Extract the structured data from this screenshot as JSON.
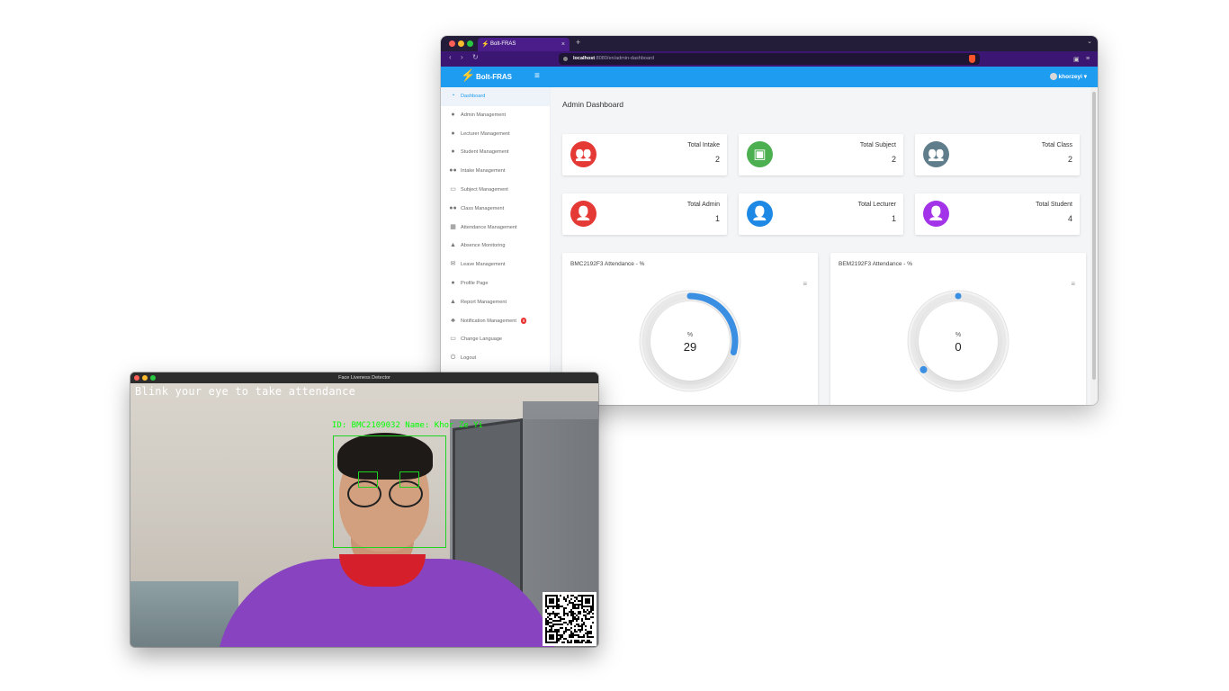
{
  "browser": {
    "tab_title": "Bolt-FRAS",
    "tab_close": "×",
    "new_tab": "+",
    "url_host": "localhost",
    "url_path": ":8080/en/admin-dashboard",
    "user_name": "khorzeyi",
    "user_caret": "▾"
  },
  "app": {
    "brand": "Bolt-FRAS",
    "menu_icon": "≡"
  },
  "sidebar": {
    "items": [
      {
        "label": "Dashboard",
        "icon": "dashboard-icon",
        "glyph": "◔",
        "active": true
      },
      {
        "label": "Admin Management",
        "icon": "user-icon",
        "glyph": "●"
      },
      {
        "label": "Lecturer Management",
        "icon": "user-icon",
        "glyph": "●"
      },
      {
        "label": "Student Management",
        "icon": "user-icon",
        "glyph": "●"
      },
      {
        "label": "Intake Management",
        "icon": "users-icon",
        "glyph": "●●"
      },
      {
        "label": "Subject Management",
        "icon": "chalkboard-icon",
        "glyph": "▭"
      },
      {
        "label": "Class Management",
        "icon": "group-icon",
        "glyph": "●●"
      },
      {
        "label": "Attendance Management",
        "icon": "calendar-icon",
        "glyph": "▦"
      },
      {
        "label": "Absence Monitoring",
        "icon": "warning-icon",
        "glyph": "▲"
      },
      {
        "label": "Leave Management",
        "icon": "envelope-open-icon",
        "glyph": "✉"
      },
      {
        "label": "Profile Page",
        "icon": "user-icon",
        "glyph": "●"
      },
      {
        "label": "Report Management",
        "icon": "warning-icon",
        "glyph": "▲"
      },
      {
        "label": "Notification Management",
        "icon": "bell-icon",
        "glyph": "♣",
        "badge": "8"
      },
      {
        "label": "Change Language",
        "icon": "language-icon",
        "glyph": "▭"
      },
      {
        "label": "Logout",
        "icon": "power-icon",
        "glyph": "⏻"
      }
    ]
  },
  "dashboard": {
    "title": "Admin Dashboard",
    "stats": [
      {
        "label": "Total Intake",
        "value": "2",
        "color": "#e53935",
        "icon": "users-icon"
      },
      {
        "label": "Total Subject",
        "value": "2",
        "color": "#4caf50",
        "icon": "chalkboard-icon"
      },
      {
        "label": "Total Class",
        "value": "2",
        "color": "#607d8b",
        "icon": "group-icon"
      },
      {
        "label": "Total Admin",
        "value": "1",
        "color": "#e53935",
        "icon": "user-icon"
      },
      {
        "label": "Total Lecturer",
        "value": "1",
        "color": "#1e88e5",
        "icon": "user-icon"
      },
      {
        "label": "Total Student",
        "value": "4",
        "color": "#a333e8",
        "icon": "user-icon"
      }
    ]
  },
  "chart_data": [
    {
      "type": "radial-gauge",
      "title": "BMC2192F3 Attendance - %",
      "unit_label": "%",
      "value": 29,
      "ylim": [
        0,
        100
      ],
      "color": "#3b8fe3"
    },
    {
      "type": "radial-gauge",
      "title": "BEM2192F3 Attendance - %",
      "unit_label": "%",
      "value": 0,
      "ylim": [
        0,
        100
      ],
      "color": "#3b8fe3"
    }
  ],
  "camera": {
    "window_title": "Face Liveness Detector",
    "instruction": "Blink your eye to take attendance",
    "detection_label": "ID: BMC2109032  Name: Khor Ze Yi"
  }
}
